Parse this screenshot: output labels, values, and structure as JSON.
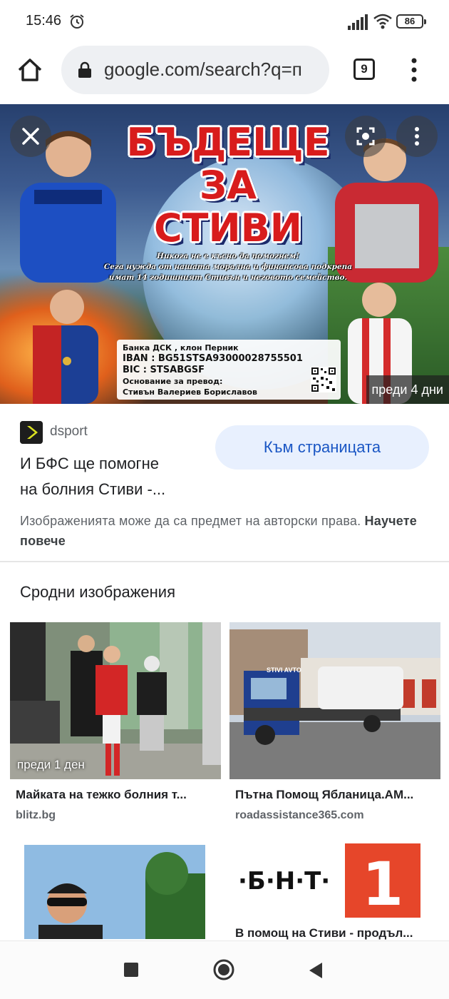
{
  "status_bar": {
    "time": "15:46",
    "battery": "86",
    "icons": [
      "alarm-icon",
      "signal-icon",
      "wifi-icon",
      "battery-icon"
    ]
  },
  "browser": {
    "url": "google.com/search?q=п",
    "tab_count": "9",
    "icons": [
      "home-icon",
      "lock-icon",
      "tabs-icon",
      "more-vert-icon"
    ]
  },
  "hero": {
    "poster_title_line1": "БЪДЕЩЕ",
    "poster_title_line2": "ЗА",
    "poster_title_line3": "СТИВИ",
    "poster_text_line1": "Никога не е късно да помогнем!",
    "poster_text_line2": "Сега нужда от нашата морална и финансова подкрепа",
    "poster_text_line3": "имат 14 годишният Стивън и неговото семейство.",
    "bank_line1": "Банка ДСК , клон Перник",
    "bank_line2": "IBAN : BG51STSA93000028755501",
    "bank_line3": "BIC    : STSABGSF",
    "bank_line4": "Основание за превод:",
    "bank_line5": "Стивън Валериев Бориславов",
    "time_badge": "преди 4 дни",
    "accent": "#d81c1c"
  },
  "source": {
    "site_name": "dsport",
    "title_line1": "И БФС ще помогне",
    "title_line2": "на болния Стиви -...",
    "visit_button": "Към страницата",
    "copyright_text": "Изображенията може да са предмет на авторски права.",
    "learn_more": "Научете повече",
    "button_color": "#e8f0fe",
    "button_text_color": "#1a56c4"
  },
  "related": {
    "heading": "Сродни изображения",
    "items": [
      {
        "title": "Майката на тежко болния т...",
        "site": "blitz.bg",
        "badge": "преди 1 ден"
      },
      {
        "title": "Пътна Помощ Ябланица.АМ...",
        "site": "roadassistance365.com",
        "truck_text": "STIVI AVTO",
        "badge": ""
      },
      {
        "title": "",
        "site": "",
        "badge": ""
      },
      {
        "title": "В помощ на Стиви - продъл...",
        "site": "",
        "logo_text": "·Б·Н·Т·",
        "logo_number": "1",
        "badge": ""
      }
    ]
  },
  "nav": {
    "icons": [
      "recents-icon",
      "home-circle-icon",
      "back-icon"
    ]
  }
}
